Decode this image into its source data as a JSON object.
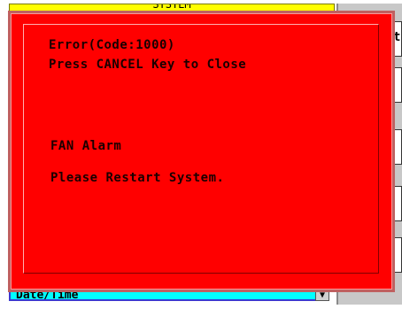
{
  "background": {
    "title_label": "SYSTEM",
    "right_panel_letter": "t",
    "date_field_label": "Date/Time",
    "dropdown_glyph": "▼"
  },
  "dialog": {
    "error_line": "Error(Code:1000)",
    "instruction_line": "Press CANCEL Key to Close",
    "alarm_name": "FAN Alarm",
    "action_message": "Please Restart System.",
    "background_color": "#ff0000"
  },
  "colors": {
    "title_bar": "#ffff00",
    "date_field": "#00ffff",
    "dialog": "#ff0000"
  }
}
